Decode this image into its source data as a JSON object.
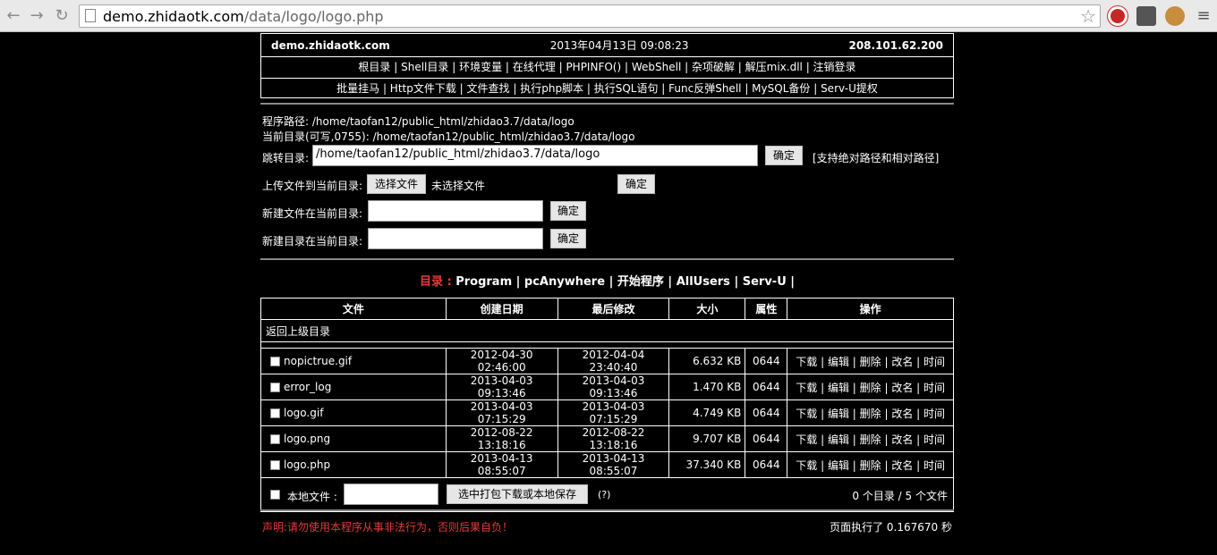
{
  "browser": {
    "url_host": "demo.zhidaotk.com",
    "url_path": "/data/logo/logo.php"
  },
  "header": {
    "site": "demo.zhidaotk.com",
    "datetime": "2013年04月13日 09:08:23",
    "ip": "208.101.62.200"
  },
  "menu1": [
    "根目录",
    "Shell目录",
    "环境变量",
    "在线代理",
    "PHPINFO()",
    "WebShell",
    "杂项破解",
    "解压mix.dll",
    "注销登录"
  ],
  "menu2": [
    "批量挂马",
    "Http文件下载",
    "文件查找",
    "执行php脚本",
    "执行SQL语句",
    "Func反弹Shell",
    "MySQL备份",
    "Serv-U提权"
  ],
  "paths": {
    "program_path": "程序路径: /home/taofan12/public_html/zhidao3.7/data/logo",
    "current_dir": "当前目录(可写,0755): /home/taofan12/public_html/zhidao3.7/data/logo",
    "jump_label": "跳转目录:",
    "jump_value": "/home/taofan12/public_html/zhidao3.7/data/logo",
    "jump_btn": "确定",
    "jump_hint": "[支持绝对路径和相对路径]"
  },
  "upload": {
    "label": "上传文件到当前目录:",
    "choose_btn": "选择文件",
    "no_file": "未选择文件",
    "ok_btn": "确定"
  },
  "new_file": {
    "label": "新建文件在当前目录:",
    "ok_btn": "确定"
  },
  "new_dir": {
    "label": "新建目录在当前目录:",
    "ok_btn": "确定"
  },
  "dirs": {
    "label": "目录 :",
    "items": [
      "Program",
      "pcAnywhere",
      "开始程序",
      "AllUsers",
      "Serv-U"
    ]
  },
  "table": {
    "headers": [
      "文件",
      "创建日期",
      "最后修改",
      "大小",
      "属性",
      "操作"
    ],
    "parent": "返回上级目录",
    "rows": [
      {
        "name": "nopictrue.gif",
        "created": "2012-04-30 02:46:00",
        "modified": "2012-04-04 23:40:40",
        "size": "6.632 KB",
        "perm": "0644"
      },
      {
        "name": "error_log",
        "created": "2013-04-03 09:13:46",
        "modified": "2013-04-03 09:13:46",
        "size": "1.470 KB",
        "perm": "0644"
      },
      {
        "name": "logo.gif",
        "created": "2013-04-03 07:15:29",
        "modified": "2013-04-03 07:15:29",
        "size": "4.749 KB",
        "perm": "0644"
      },
      {
        "name": "logo.png",
        "created": "2012-08-22 13:18:16",
        "modified": "2012-08-22 13:18:16",
        "size": "9.707 KB",
        "perm": "0644"
      },
      {
        "name": "logo.php",
        "created": "2013-04-13 08:55:07",
        "modified": "2013-04-13 08:55:07",
        "size": "37.340 KB",
        "perm": "0644"
      }
    ],
    "ops": [
      "下载",
      "编辑",
      "删除",
      "改名",
      "时间"
    ],
    "local_label": "本地文件 :",
    "pack_btn": "选中打包下载或本地保存",
    "help": "(?)",
    "summary": "0 个目录 / 5 个文件"
  },
  "footer": {
    "disclaimer": "声明:请勿使用本程序从事非法行为，否则后果自负！",
    "exec_time": "页面执行了 0.167670 秒"
  },
  "colors": {
    "accent_red": "#e83a3a",
    "background": "#000000",
    "text": "#ffffff"
  }
}
